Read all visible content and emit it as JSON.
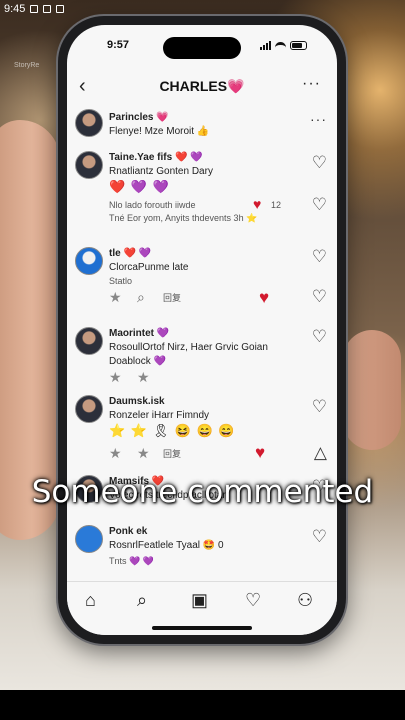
{
  "system_bar": {
    "time": "9:45"
  },
  "watermark": "StoryRe",
  "phone_status": {
    "time": "9:57"
  },
  "header": {
    "back": "‹",
    "title": "CHARLES",
    "title_emoji": "💗",
    "more": "···"
  },
  "feed": [
    {
      "name": "Parincles 💗",
      "line1": "Flenye! Mze Moroit 👍",
      "more": "···"
    },
    {
      "name": "Taine.Yae fifs ❤️ 💜",
      "line1": "Rnatliantz Gonten Dary",
      "emojis": "❤️ 💜 💜",
      "line2": "Nlo lado forouth iiwde",
      "line2_count": "12",
      "line3": "Tné Eor yom, Anyits thdevents 3h ⭐"
    },
    {
      "name": "tle ❤️ 💜",
      "line1": "ClorcaPunme late",
      "line2": "Statlo"
    },
    {
      "reply_label": "回复"
    },
    {
      "name": "Maorintet 💜",
      "line1": "RosoullOrtof Nirz, Haer Grvic Goian",
      "line2": "Doablock 💜"
    },
    {
      "name": "Daumsk.isk",
      "line1": "Ronzeler iHarr Fimndy",
      "emojis": "⭐ ⭐ 🎗 😆 😄 😄",
      "reply_label": "回复"
    },
    {
      "name": "Mamsifs ❤️",
      "line1": "Volecfrets trecfidpfaclliotar"
    },
    {
      "name": "Ponk ek",
      "line1": "RosnrlFeatlele Tyaal 🤩 0",
      "line2": "Tnts 💜 💜"
    }
  ],
  "caption": "Someone commented",
  "nav": {
    "home": "⌂",
    "search": "⌕",
    "reels": "▣",
    "activity": "♡",
    "profile": "⚇"
  },
  "colors": {
    "accent_red": "#d21a2e",
    "screen_bg": "#f7f7f7"
  }
}
